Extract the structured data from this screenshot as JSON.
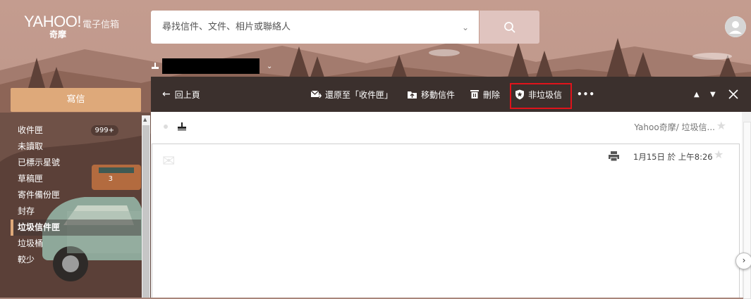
{
  "header": {
    "logo_text": "YAHOO!",
    "logo_sub": "電子信箱",
    "logo_cn": "奇摩",
    "search_placeholder": "尋找信件、文件、相片或聯絡人"
  },
  "sidebar": {
    "compose_label": "寫信",
    "folders": [
      {
        "label": "收件匣",
        "count": "999+"
      },
      {
        "label": "未讀取",
        "count": ""
      },
      {
        "label": "已標示星號",
        "count": ""
      },
      {
        "label": "草稿匣",
        "count": "3"
      },
      {
        "label": "寄件備份匣",
        "count": ""
      },
      {
        "label": "封存",
        "count": ""
      },
      {
        "label": "垃圾信件匣",
        "count": ""
      },
      {
        "label": "垃圾桶",
        "count": ""
      },
      {
        "label": "較少",
        "count": ""
      }
    ]
  },
  "toolbar": {
    "back_label": "回上頁",
    "restore_label": "還原至「收件匣」",
    "move_label": "移動信件",
    "delete_label": "刪除",
    "not_spam_label": "非垃圾信",
    "more_label": "•••"
  },
  "message": {
    "folder_path": "Yahoo奇摩/  垃圾信...",
    "date": "1月15日 於 上午8:26"
  },
  "colors": {
    "toolbar_bg": "#3b302d",
    "compose_bg": "#dea97a",
    "highlight": "#e0131b"
  },
  "icons": [
    "search-icon",
    "user-icon",
    "back-arrow-icon",
    "restore-icon",
    "move-icon",
    "trash-icon",
    "shield-icon",
    "more-icon",
    "up-icon",
    "down-icon",
    "close-icon",
    "star-icon",
    "print-icon",
    "chevron-right-icon"
  ]
}
